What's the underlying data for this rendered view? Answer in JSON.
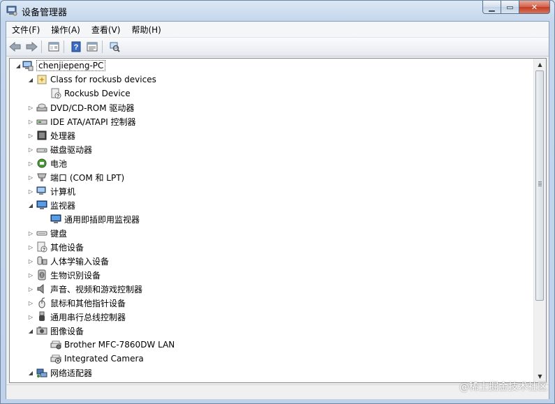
{
  "window": {
    "title": "设备管理器"
  },
  "caption_buttons": {
    "minimize": "▁",
    "maximize": "▭",
    "close": "✕"
  },
  "menubar": [
    {
      "label": "文件(F)"
    },
    {
      "label": "操作(A)"
    },
    {
      "label": "查看(V)"
    },
    {
      "label": "帮助(H)"
    }
  ],
  "toolbar": [
    {
      "name": "back-icon"
    },
    {
      "name": "forward-icon"
    },
    {
      "name": "show-hide-console-tree-icon"
    },
    {
      "name": "help-icon"
    },
    {
      "name": "properties-icon"
    },
    {
      "name": "scan-hardware-icon"
    }
  ],
  "tree": {
    "root": {
      "label": "chenjiepeng-PC",
      "icon": "computer-icon",
      "expanded": true
    },
    "categories": [
      {
        "label": "Class for rockusb devices",
        "icon": "device-class-icon",
        "expanded": true,
        "children": [
          {
            "label": "Rockusb Device",
            "icon": "unknown-device-icon"
          }
        ]
      },
      {
        "label": "DVD/CD-ROM 驱动器",
        "icon": "dvd-drive-icon",
        "expanded": false
      },
      {
        "label": "IDE ATA/ATAPI 控制器",
        "icon": "ide-controller-icon",
        "expanded": false
      },
      {
        "label": "处理器",
        "icon": "processor-icon",
        "expanded": false
      },
      {
        "label": "磁盘驱动器",
        "icon": "disk-drive-icon",
        "expanded": false
      },
      {
        "label": "电池",
        "icon": "battery-icon",
        "expanded": false
      },
      {
        "label": "端口 (COM 和 LPT)",
        "icon": "port-icon",
        "expanded": false
      },
      {
        "label": "计算机",
        "icon": "computer-icon",
        "expanded": false
      },
      {
        "label": "监视器",
        "icon": "monitor-icon",
        "expanded": true,
        "children": [
          {
            "label": "通用即插即用监视器",
            "icon": "monitor-icon"
          }
        ]
      },
      {
        "label": "键盘",
        "icon": "keyboard-icon",
        "expanded": false
      },
      {
        "label": "其他设备",
        "icon": "other-devices-icon",
        "expanded": false
      },
      {
        "label": "人体学输入设备",
        "icon": "hid-icon",
        "expanded": false
      },
      {
        "label": "生物识别设备",
        "icon": "biometric-icon",
        "expanded": false
      },
      {
        "label": "声音、视频和游戏控制器",
        "icon": "speaker-icon",
        "expanded": false
      },
      {
        "label": "鼠标和其他指针设备",
        "icon": "mouse-icon",
        "expanded": false
      },
      {
        "label": "通用串行总线控制器",
        "icon": "usb-icon",
        "expanded": false
      },
      {
        "label": "图像设备",
        "icon": "imaging-icon",
        "expanded": true,
        "children": [
          {
            "label": "Brother MFC-7860DW LAN",
            "icon": "scanner-icon"
          },
          {
            "label": "Integrated Camera",
            "icon": "camera-icon"
          }
        ]
      },
      {
        "label": "网络适配器",
        "icon": "network-adapter-icon",
        "expanded": true
      }
    ]
  },
  "watermark": "@稀土掘金技术社区"
}
